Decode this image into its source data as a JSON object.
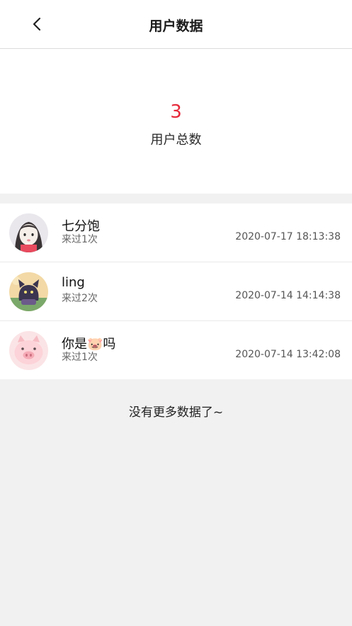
{
  "header": {
    "title": "用户数据",
    "back_icon": "chevron-left-icon"
  },
  "summary": {
    "count": "3",
    "label": "用户总数",
    "count_color": "#e6293a"
  },
  "users": [
    {
      "name": "七分饱",
      "visits": "来过1次",
      "time": "2020-07-17 18:13:38",
      "avatar": "avatar-girl"
    },
    {
      "name": "ling",
      "visits": "来过2次",
      "time": "2020-07-14 14:14:38",
      "avatar": "avatar-cat"
    },
    {
      "name": "你是🐷吗",
      "visits": "来过1次",
      "time": "2020-07-14 13:42:08",
      "avatar": "avatar-pig"
    }
  ],
  "footer": {
    "no_more": "没有更多数据了~"
  }
}
